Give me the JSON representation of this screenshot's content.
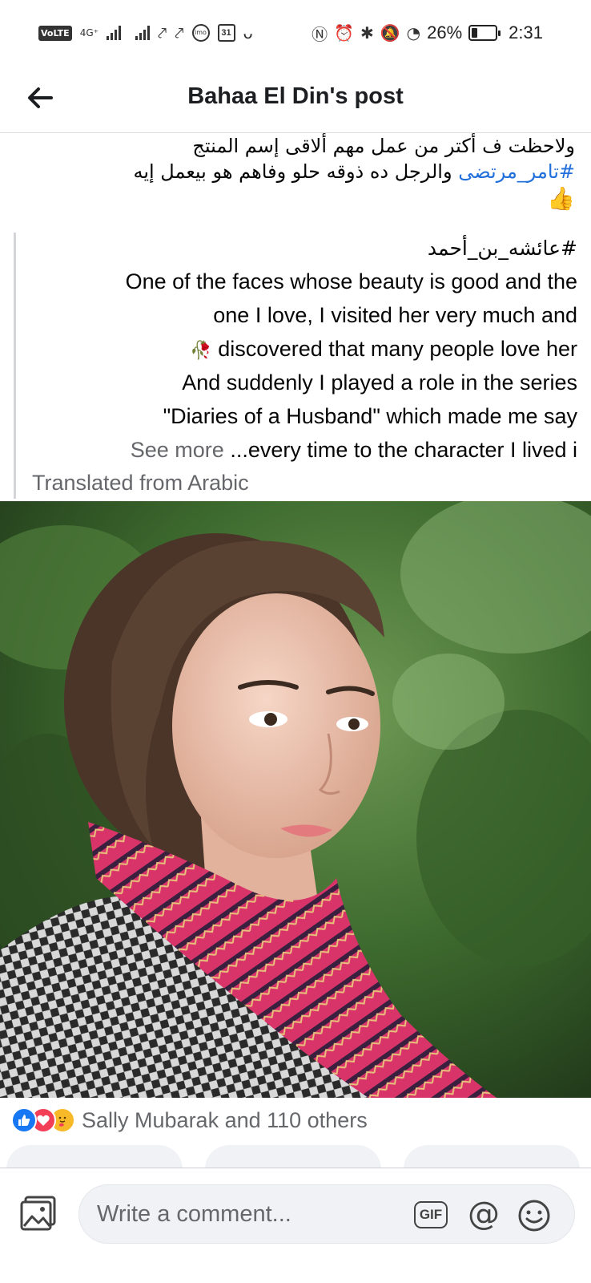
{
  "status_bar": {
    "volte": "VoLTE",
    "network": "4G⁺",
    "battery": "26%",
    "battery_level": 0.26,
    "time": "2:31",
    "calendar_day": "31",
    "icons": [
      "signal-icon",
      "missed-call-icon",
      "imo-icon",
      "calendar-icon",
      "nfc-icon",
      "alarm-icon",
      "bluetooth-icon",
      "mute-icon",
      "data-saver-icon",
      "battery-icon"
    ]
  },
  "header": {
    "title": "Bahaa El Din's post"
  },
  "post": {
    "arabic_line1": "ولاحظت ف أكتر من عمل مهم ألاقى إسم المنتج",
    "hashtag_1": "#تامر_مرتضى",
    "arabic_line2_rest": " والرجل ده ذوقه حلو وفاهم هو بيعمل إيه",
    "thumbs_emoji": "👍",
    "quote_hashtag": "#عائشه_بن_أحمد",
    "translated_lines": [
      "One of the faces whose beauty is good and the",
      "one I love, I visited her very much and",
      "discovered that many people love her",
      "And suddenly I played a role in the series",
      "\"Diaries of a Husband\" which made me say"
    ],
    "last_line": "...every time to the character I lived i",
    "see_more": "See more",
    "rose_emoji": "🥀",
    "translated_from": "Translated from Arabic"
  },
  "reactions": {
    "label": "Sally Mubarak and 110 others",
    "types": [
      "like",
      "love",
      "care"
    ],
    "colors": {
      "like": "#1877f2",
      "love": "#f33e58",
      "care": "#f7b928"
    }
  },
  "comment_bar": {
    "placeholder": "Write a comment...",
    "gif_label": "GIF",
    "at_label": "@"
  },
  "colors": {
    "hashtag": "#216fdb",
    "secondary_text": "#65676b",
    "input_bg": "#f0f2f5"
  }
}
